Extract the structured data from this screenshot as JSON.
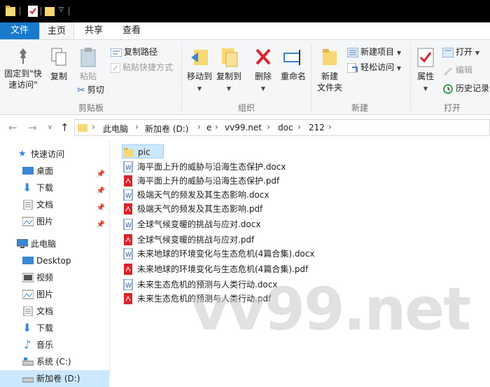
{
  "ribbon_tabs": {
    "file": "文件",
    "home": "主页",
    "share": "共享",
    "view": "查看"
  },
  "clipboard": {
    "pin_label_1": "固定到\"快",
    "pin_label_2": "速访问\"",
    "copy": "复制",
    "paste": "粘贴",
    "copy_path": "复制路径",
    "paste_shortcut": "粘贴快捷方式",
    "cut": "剪切",
    "group_label": "剪贴板"
  },
  "organize": {
    "move_to": "移动到",
    "copy_to": "复制到",
    "delete": "删除",
    "rename": "重命名",
    "group_label": "组织"
  },
  "new_group": {
    "new_folder_1": "新建",
    "new_folder_2": "文件夹",
    "new_item": "新建项目",
    "easy_access": "轻松访问",
    "group_label": "新建"
  },
  "open_group": {
    "properties": "属性",
    "open": "打开",
    "edit": "编辑",
    "history": "历史记录",
    "group_label": "打开"
  },
  "breadcrumb": [
    "此电脑",
    "新加卷 (D:)",
    "e",
    "vv99.net",
    "doc",
    "212"
  ],
  "nav_pane": {
    "quick_access": "快速访问",
    "quick_items": [
      "桌面",
      "下载",
      "文档",
      "图片"
    ],
    "this_pc": "此电脑",
    "pc_items": [
      "Desktop",
      "视频",
      "图片",
      "文档",
      "下载",
      "音乐",
      "系统 (C:)",
      "新加卷 (D:)"
    ]
  },
  "files": [
    {
      "name": "pic",
      "type": "folder"
    },
    {
      "name": "海平面上升的威胁与沿海生态保护.docx",
      "type": "docx"
    },
    {
      "name": "海平面上升的威胁与沿海生态保护.pdf",
      "type": "pdf"
    },
    {
      "name": "极端天气的频发及其生态影响.docx",
      "type": "docx"
    },
    {
      "name": "极端天气的频发及其生态影响.pdf",
      "type": "pdf"
    },
    {
      "name": "全球气候变暖的挑战与应对.docx",
      "type": "docx"
    },
    {
      "name": "全球气候变暖的挑战与应对.pdf",
      "type": "pdf"
    },
    {
      "name": "未来地球的环境变化与生态危机(4篇合集).docx",
      "type": "docx"
    },
    {
      "name": "未来地球的环境变化与生态危机(4篇合集).pdf",
      "type": "pdf"
    },
    {
      "name": "未来生态危机的预测与人类行动.docx",
      "type": "docx"
    },
    {
      "name": "未来生态危机的预测与人类行动.pdf",
      "type": "pdf"
    }
  ],
  "watermark": "vv99.net",
  "colors": {
    "file_tab": "#1979ca",
    "selection": "#cce8ff",
    "folder": "#f8d775",
    "pdf": "#d9232d",
    "docx": "#2b579a"
  }
}
